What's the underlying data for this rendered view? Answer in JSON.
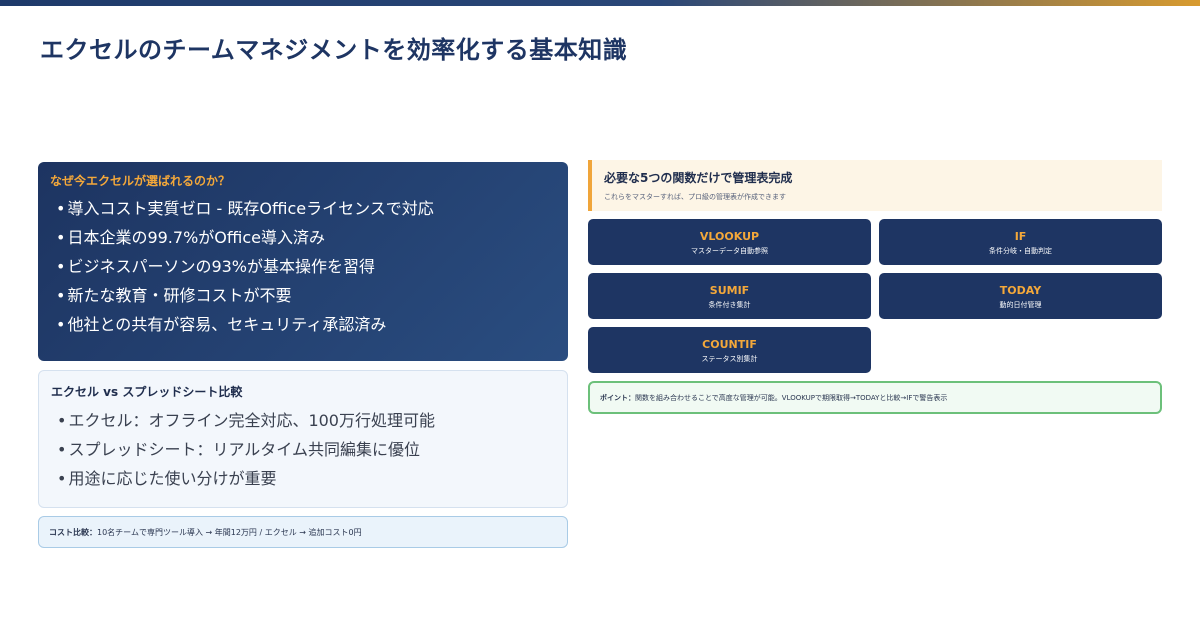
{
  "title": "エクセルのチームマネジメントを効率化する基本知識",
  "why": {
    "title": "なぜ今エクセルが選ばれるのか？",
    "items": [
      "導入コスト実質ゼロ - 既存Officeライセンスで対応",
      "日本企業の99.7%がOffice導入済み",
      "ビジネスパーソンの93%が基本操作を習得",
      "新たな教育・研修コストが不要",
      "他社との共有が容易、セキュリティ承認済み"
    ]
  },
  "compare": {
    "title": "エクセル vs スプレッドシート比較",
    "items": [
      "エクセル：オフライン完全対応、100万行処理可能",
      "スプレッドシート：リアルタイム共同編集に優位",
      "用途に応じた使い分けが重要"
    ]
  },
  "cost": {
    "label": "コスト比較：",
    "text": "10名チームで専門ツール導入 → 年間12万円 / エクセル → 追加コスト0円"
  },
  "functions": {
    "title": "必要な5つの関数だけで管理表完成",
    "subtitle": "これらをマスターすれば、プロ級の管理表が作成できます",
    "cards": [
      {
        "name": "VLOOKUP",
        "desc": "マスターデータ自動参照"
      },
      {
        "name": "IF",
        "desc": "条件分岐・自動判定"
      },
      {
        "name": "SUMIF",
        "desc": "条件付き集計"
      },
      {
        "name": "TODAY",
        "desc": "動的日付管理"
      },
      {
        "name": "COUNTIF",
        "desc": "ステータス別集計"
      }
    ]
  },
  "point": {
    "label": "ポイント：",
    "text": "関数を組み合わせることで高度な管理が可能。VLOOKUPで期限取得→TODAYと比較→IFで警告表示"
  },
  "colors": {
    "navy": "#1e3563",
    "accent": "#f4a83a",
    "green": "#6cc07a"
  }
}
